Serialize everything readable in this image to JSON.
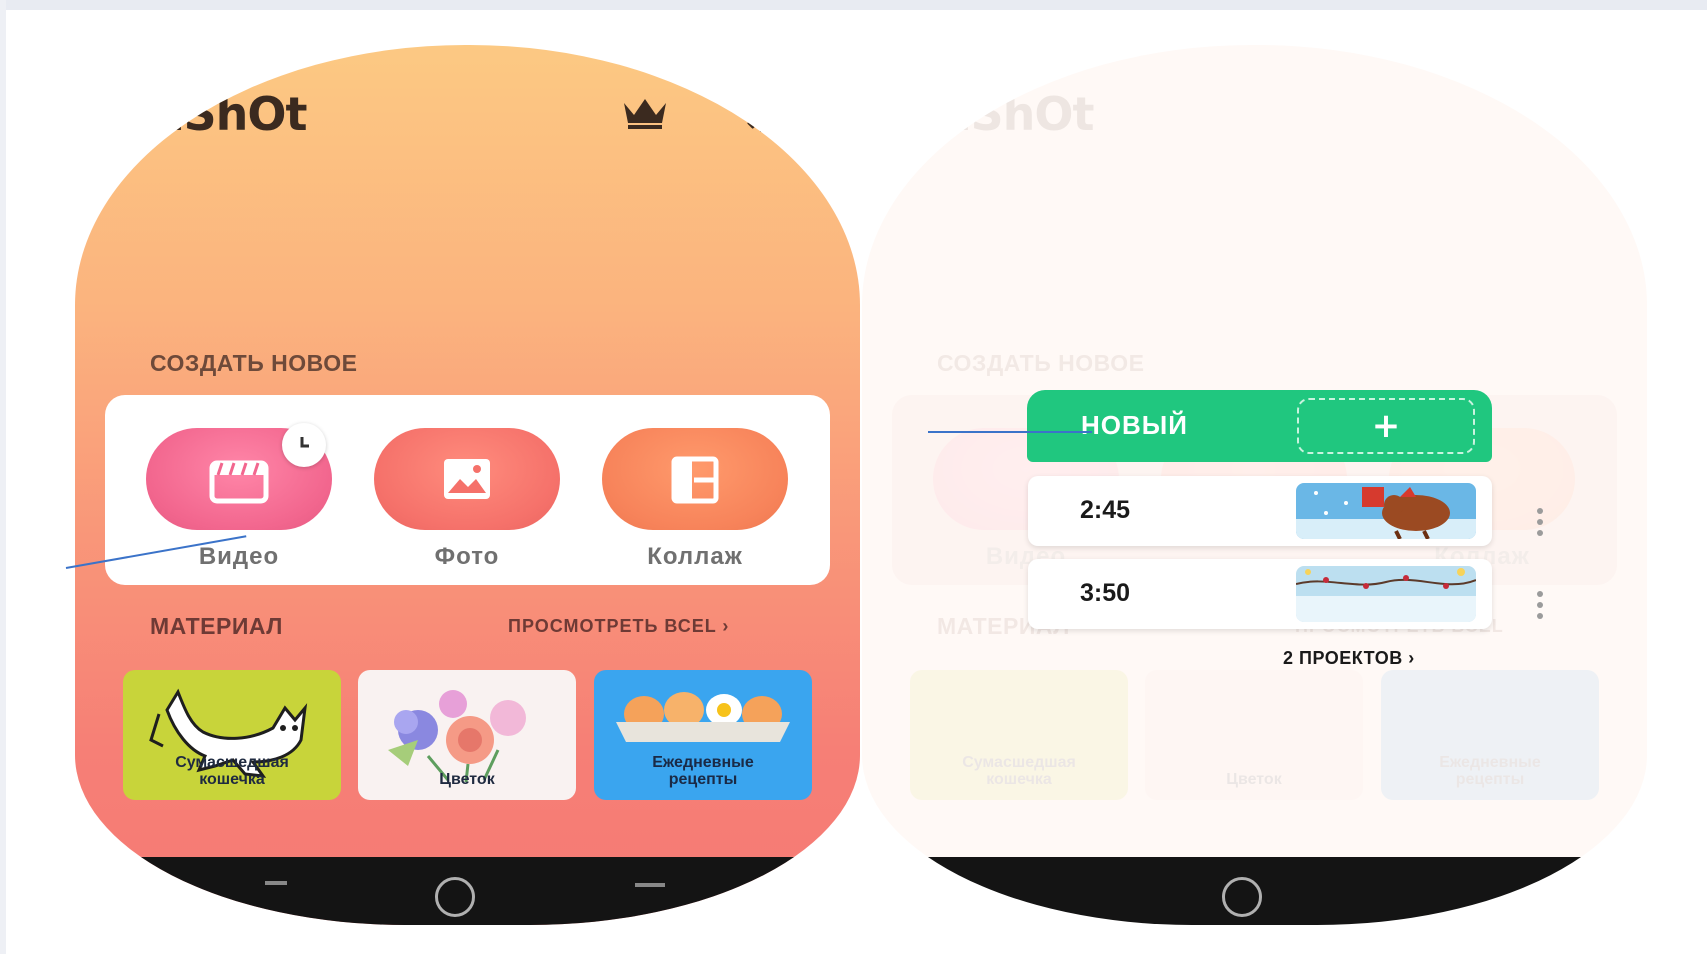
{
  "app": {
    "logo_text": "inShOt",
    "icons": [
      "crown-icon",
      "gear-icon"
    ]
  },
  "create_section": {
    "title": "СОЗДАТЬ НОВОЕ",
    "buttons": [
      {
        "label": "Видео",
        "icon": "clapperboard-icon",
        "badge_icon": "clock-icon"
      },
      {
        "label": "Фото",
        "icon": "image-icon"
      },
      {
        "label": "Коллаж",
        "icon": "collage-icon"
      }
    ]
  },
  "material_section": {
    "title": "МАТЕРИАЛ",
    "view_all": "ПРОСМОТРЕТЬ ВСЕL",
    "tiles": [
      {
        "label_line1": "Сумасшедшая",
        "label_line2": "кошечка"
      },
      {
        "label_line1": "Цветок",
        "label_line2": ""
      },
      {
        "label_line1": "Ежедневные",
        "label_line2": "рецепты"
      }
    ]
  },
  "new_popup": {
    "new_label": "НОВЫЙ",
    "plus": "+",
    "projects": [
      {
        "duration": "2:45"
      },
      {
        "duration": "3:50"
      }
    ],
    "projects_count": "2 ПРОЕКТОВ"
  },
  "colors": {
    "accent_green": "#20c77f",
    "video_pink": "#f2668e",
    "photo_red": "#f5716a",
    "collage_orange": "#f7835a",
    "annotation_blue": "#3b73c9"
  }
}
